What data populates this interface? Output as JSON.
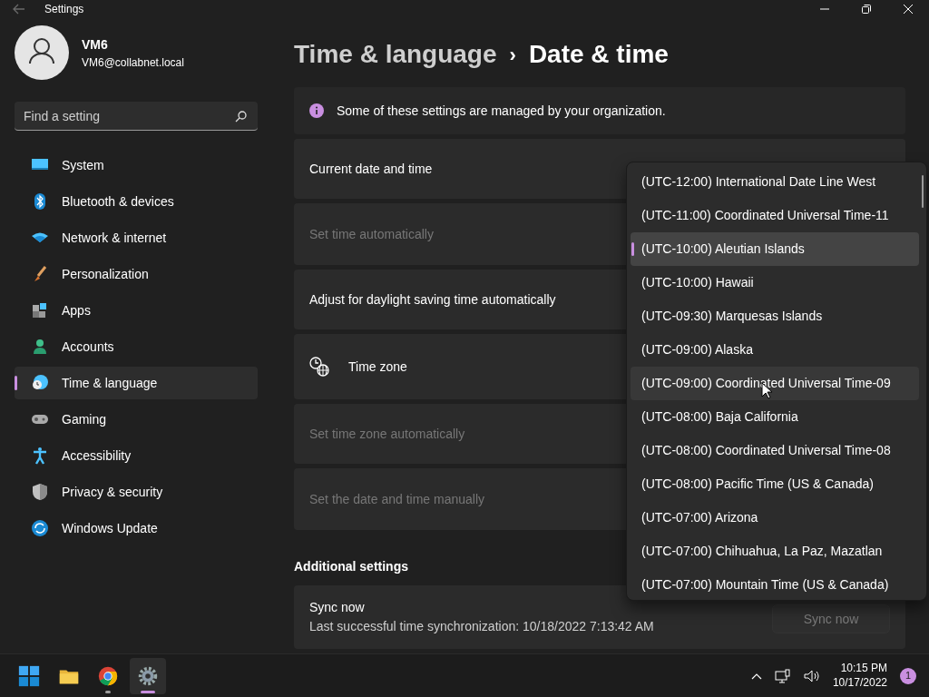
{
  "window": {
    "title": "Settings"
  },
  "account": {
    "name": "VM6",
    "email": "VM6@collabnet.local"
  },
  "search": {
    "placeholder": "Find a setting"
  },
  "sidebar": {
    "items": [
      {
        "label": "System",
        "selected": false
      },
      {
        "label": "Bluetooth & devices",
        "selected": false
      },
      {
        "label": "Network & internet",
        "selected": false
      },
      {
        "label": "Personalization",
        "selected": false
      },
      {
        "label": "Apps",
        "selected": false
      },
      {
        "label": "Accounts",
        "selected": false
      },
      {
        "label": "Time & language",
        "selected": true
      },
      {
        "label": "Gaming",
        "selected": false
      },
      {
        "label": "Accessibility",
        "selected": false
      },
      {
        "label": "Privacy & security",
        "selected": false
      },
      {
        "label": "Windows Update",
        "selected": false
      }
    ]
  },
  "breadcrumb": {
    "parent": "Time & language",
    "separator": "›",
    "current": "Date & time"
  },
  "notice": "Some of these settings are managed by your organization.",
  "settings": [
    {
      "kind": "plain",
      "label": "Current date and time",
      "disabled": false
    },
    {
      "kind": "plain",
      "label": "Set time automatically",
      "disabled": true
    },
    {
      "kind": "plain",
      "label": "Adjust for daylight saving time automatically",
      "disabled": false
    },
    {
      "kind": "timezone",
      "label": "Time zone",
      "disabled": false
    },
    {
      "kind": "plain",
      "label": "Set time zone automatically",
      "disabled": true
    },
    {
      "kind": "plain",
      "label": "Set the date and time manually",
      "disabled": true
    }
  ],
  "timezone_list": [
    {
      "label": "(UTC-12:00) International Date Line West",
      "selected": false,
      "hovered": false
    },
    {
      "label": "(UTC-11:00) Coordinated Universal Time-11",
      "selected": false,
      "hovered": false
    },
    {
      "label": "(UTC-10:00) Aleutian Islands",
      "selected": true,
      "hovered": false
    },
    {
      "label": "(UTC-10:00) Hawaii",
      "selected": false,
      "hovered": false
    },
    {
      "label": "(UTC-09:30) Marquesas Islands",
      "selected": false,
      "hovered": false
    },
    {
      "label": "(UTC-09:00) Alaska",
      "selected": false,
      "hovered": false
    },
    {
      "label": "(UTC-09:00) Coordinated Universal Time-09",
      "selected": false,
      "hovered": true
    },
    {
      "label": "(UTC-08:00) Baja California",
      "selected": false,
      "hovered": false
    },
    {
      "label": "(UTC-08:00) Coordinated Universal Time-08",
      "selected": false,
      "hovered": false
    },
    {
      "label": "(UTC-08:00) Pacific Time (US & Canada)",
      "selected": false,
      "hovered": false
    },
    {
      "label": "(UTC-07:00) Arizona",
      "selected": false,
      "hovered": false
    },
    {
      "label": "(UTC-07:00) Chihuahua, La Paz, Mazatlan",
      "selected": false,
      "hovered": false
    },
    {
      "label": "(UTC-07:00) Mountain Time (US & Canada)",
      "selected": false,
      "hovered": false
    }
  ],
  "additional": {
    "heading": "Additional settings",
    "sync_title": "Sync now",
    "sync_detail": "Last successful time synchronization: 10/18/2022 7:13:42 AM",
    "sync_button": {
      "label": "Sync now",
      "disabled": true
    }
  },
  "taskbar": {
    "apps": [
      {
        "kind": "start",
        "active": false
      },
      {
        "kind": "explorer",
        "active": false
      },
      {
        "kind": "chrome",
        "active": false,
        "running": true
      },
      {
        "kind": "settings",
        "active": true,
        "running": true
      }
    ],
    "time": "10:15 PM",
    "date": "10/17/2022",
    "notifications": "1"
  }
}
